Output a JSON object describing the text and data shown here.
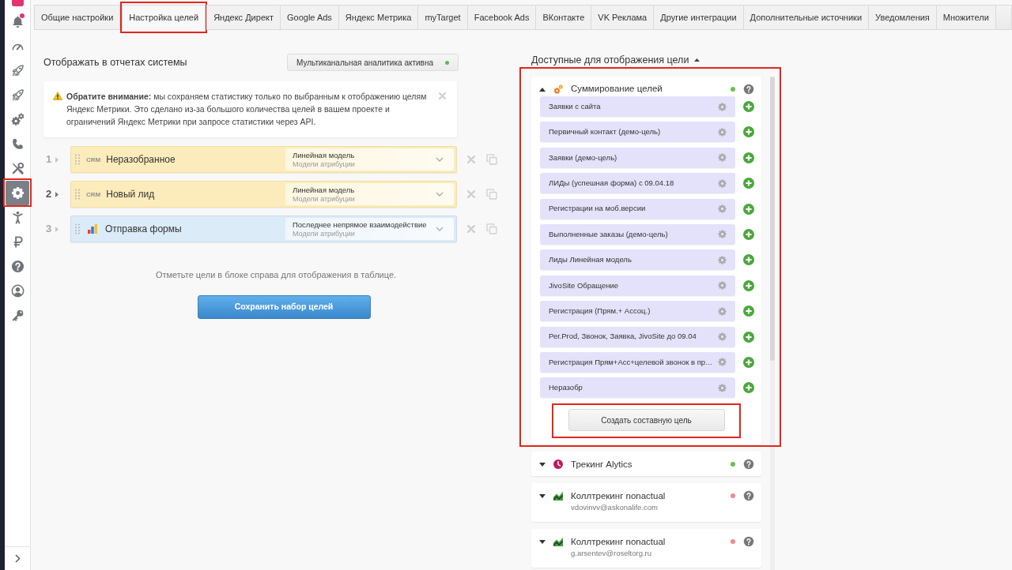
{
  "sidebar": {
    "items": [
      {
        "kind": "bell",
        "notification": true,
        "selected": false,
        "highlighted": false
      },
      {
        "kind": "gauge",
        "notification": false,
        "selected": false,
        "highlighted": false
      },
      {
        "kind": "rocket",
        "notification": false,
        "selected": false,
        "highlighted": false
      },
      {
        "kind": "rocket",
        "notification": false,
        "selected": false,
        "highlighted": false
      },
      {
        "kind": "gears",
        "notification": false,
        "selected": false,
        "highlighted": false
      },
      {
        "kind": "phone",
        "notification": false,
        "selected": false,
        "highlighted": false
      },
      {
        "kind": "tools",
        "notification": false,
        "selected": false,
        "highlighted": false
      },
      {
        "kind": "gear",
        "notification": false,
        "selected": true,
        "highlighted": true
      },
      {
        "kind": "person",
        "notification": false,
        "selected": false,
        "highlighted": false
      },
      {
        "kind": "ruble",
        "notification": false,
        "selected": false,
        "highlighted": false
      },
      {
        "kind": "help",
        "notification": false,
        "selected": false,
        "highlighted": false
      },
      {
        "kind": "user",
        "notification": false,
        "selected": false,
        "highlighted": false
      },
      {
        "kind": "key",
        "notification": false,
        "selected": false,
        "highlighted": false
      }
    ]
  },
  "tabs": [
    {
      "label": "Общие настройки",
      "selected": false,
      "highlighted": false
    },
    {
      "label": "Настройка целей",
      "selected": true,
      "highlighted": true
    },
    {
      "label": "Яндекс Директ",
      "selected": false,
      "highlighted": false
    },
    {
      "label": "Google Ads",
      "selected": false,
      "highlighted": false
    },
    {
      "label": "Яндекс Метрика",
      "selected": false,
      "highlighted": false
    },
    {
      "label": "myTarget",
      "selected": false,
      "highlighted": false
    },
    {
      "label": "Facebook Ads",
      "selected": false,
      "highlighted": false
    },
    {
      "label": "ВКонтакте",
      "selected": false,
      "highlighted": false
    },
    {
      "label": "VK Реклама",
      "selected": false,
      "highlighted": false
    },
    {
      "label": "Другие интеграции",
      "selected": false,
      "highlighted": false
    },
    {
      "label": "Дополнительные источники",
      "selected": false,
      "highlighted": false
    },
    {
      "label": "Уведомления",
      "selected": false,
      "highlighted": false
    },
    {
      "label": "Множители",
      "selected": false,
      "highlighted": false
    }
  ],
  "display_panel": {
    "title": "Отображать в отчетах системы",
    "status_button": {
      "label": "Мультиканальная аналитика активна",
      "active": true
    },
    "notice": {
      "text": "**Обратите внимание:** мы сохраняем статистику только по выбранным к отображению целям Яндекс Метрики. Это сделано из-за большого количества целей в вашем проекте и ограничений Яндекс Метрики при запросе статистики через API."
    },
    "goals": [
      {
        "number": "1",
        "active": false,
        "kind": "crm",
        "source_label": "CRM",
        "name": "Неразобранное",
        "model": "Линейная модель",
        "model_label": "Модели атрибуции"
      },
      {
        "number": "2",
        "active": true,
        "kind": "crm",
        "source_label": "CRM",
        "name": "Новый лид",
        "model": "Линейная модель",
        "model_label": "Модели атрибуции"
      },
      {
        "number": "3",
        "active": false,
        "kind": "metrika",
        "name": "Отправка формы",
        "model": "Последнее непрямое взаимодействие",
        "model_label": "Модели атрибуции"
      }
    ],
    "hint": "Отметьте цели в блоке справа для отображения в таблице.",
    "save_button": "Сохранить набор целей"
  },
  "available_panel": {
    "title": "Доступные для отображения цели",
    "expanded": true,
    "sources": [
      {
        "kind": "summing",
        "title": "Суммирование целей",
        "expanded": true,
        "color": "#6cbf4f",
        "highlighted": true,
        "goals": [
          "Заявки с сайта",
          "Первичный контакт (демо-цель)",
          "Заявки (демо-цель)",
          "ЛИДы (успешная форма) с 09.04.18",
          "Регистрации на моб.версии",
          "Выполненные заказы (демо-цель)",
          "Лиды Линейная модель",
          "JivoSite Обращение",
          "Регистрация (Прям.+ Ассоц.)",
          "Рег.Prod, Звонок, Заявка, JivoSite до 09.04",
          "Регистрация Прям+Асс+целевой звонок в пр…",
          "Неразобр"
        ],
        "create_button": {
          "label": "Создать составную цель",
          "highlighted": true
        }
      },
      {
        "kind": "alytics",
        "title": "Трекинг Alytics",
        "expanded": false,
        "color": "#6cbf4f",
        "highlighted": false
      },
      {
        "kind": "calltracking",
        "title": "Коллтрекинг nonactual",
        "subtitle": "vdovinvv@askonalife.com",
        "expanded": false,
        "color": "#f08a8a",
        "highlighted": false
      },
      {
        "kind": "calltracking",
        "title": "Коллтрекинг nonactual",
        "subtitle": "g.arsentev@roseltorg.ru",
        "expanded": false,
        "color": "#f08a8a",
        "highlighted": false
      }
    ]
  }
}
